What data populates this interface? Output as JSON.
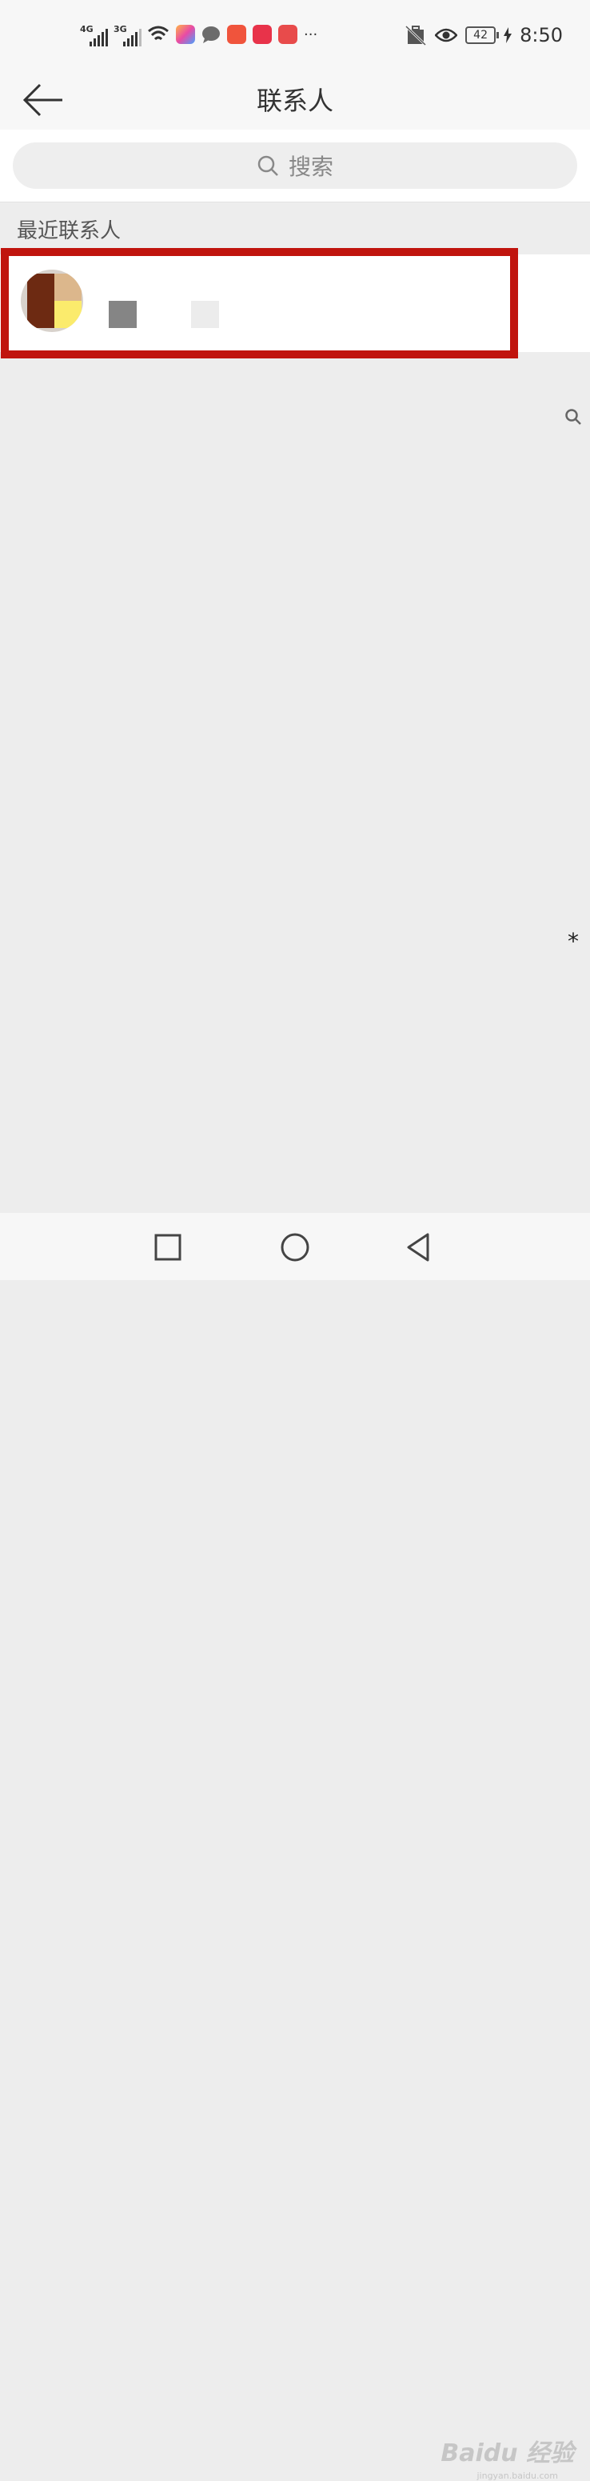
{
  "status_bar": {
    "signal_1_label": "4G",
    "signal_2_label": "3G",
    "more_label": "···",
    "battery_level": "42",
    "time": "8:50",
    "app_icons": [
      "transsion-icon",
      "message-bubble-icon",
      "wallet-icon",
      "book-icon",
      "huawei-store-icon"
    ],
    "app_icon_colors": [
      "#ff7b54",
      "#6b6b6b",
      "#f0543c",
      "#e8334a",
      "#e84b4b"
    ]
  },
  "header": {
    "title": "联系人"
  },
  "search": {
    "placeholder": "搜索"
  },
  "recent": {
    "section_label": "最近联系人"
  },
  "colors": {
    "highlight": "#c0140e",
    "background": "#ededed"
  },
  "watermark": {
    "text": "Baidu 经验",
    "sub": "jingyan.baidu.com"
  },
  "misc": {
    "star": "*"
  }
}
